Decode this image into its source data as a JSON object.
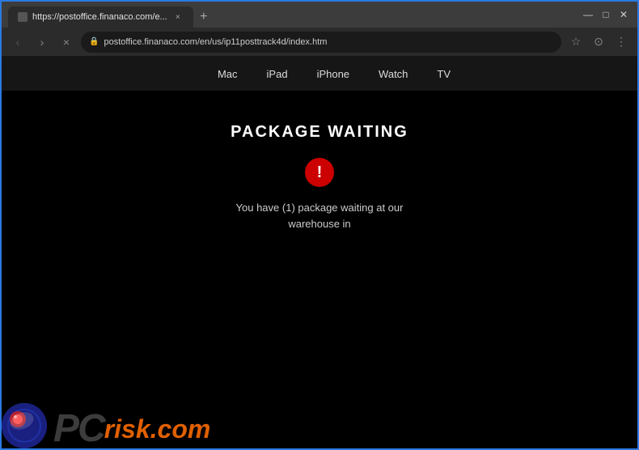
{
  "browser": {
    "tab_label": "https://postoffice.finanaco.com/e...",
    "url": "postoffice.finanaco.com/en/us/ip11posttrack4d/index.htm",
    "url_display": "postoffice.finanaco.com/en/us/ip11posttrack4d/index.htm",
    "close_label": "×",
    "new_tab_label": "+",
    "nav_back": "‹",
    "nav_forward": "›",
    "nav_refresh": "×",
    "lock_icon": "🔒",
    "star_icon": "☆",
    "account_icon": "⊙",
    "menu_icon": "⋮",
    "min_btn": "—",
    "max_btn": "□",
    "close_btn": "✕"
  },
  "apple_nav": {
    "logo": "",
    "items": [
      {
        "label": "Mac"
      },
      {
        "label": "iPad"
      },
      {
        "label": "iPhone"
      },
      {
        "label": "Watch"
      },
      {
        "label": "TV"
      }
    ]
  },
  "content": {
    "title": "PACKAGE WAITING",
    "alert_symbol": "!",
    "message_line1": "You have (1) package waiting at our",
    "message_line2": "warehouse in"
  },
  "watermark": {
    "pc_text": "PC",
    "risk_text": "risk",
    "dot_text": ".",
    "com_text": "com"
  }
}
